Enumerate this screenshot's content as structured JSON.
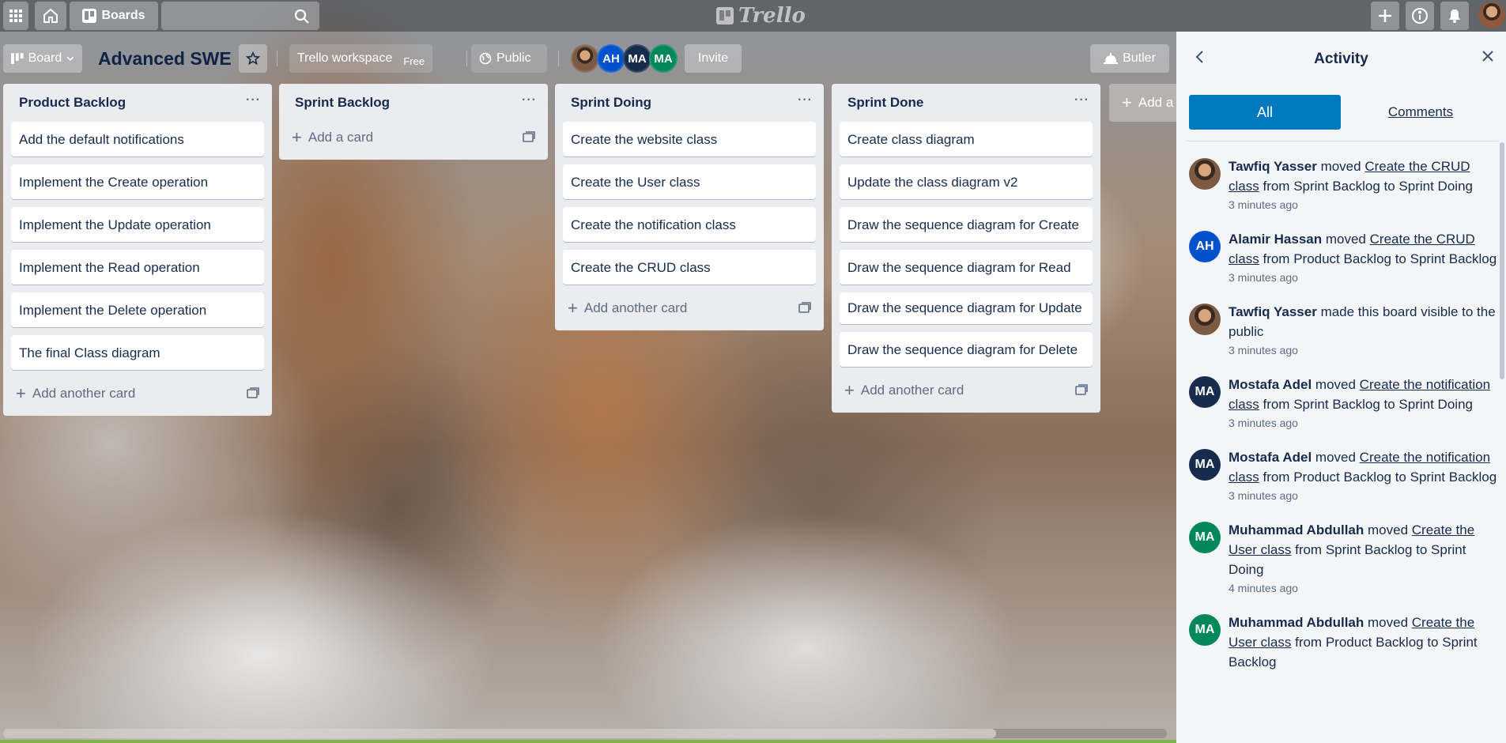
{
  "header": {
    "boards_label": "Boards",
    "logo_text": "Trello"
  },
  "board": {
    "view_label": "Board",
    "title": "Advanced SWE",
    "workspace": "Trello workspace",
    "workspace_badge": "Free",
    "visibility": "Public",
    "members": [
      "",
      "AH",
      "MA",
      "MA"
    ],
    "invite_label": "Invite",
    "butler_label": "Butler",
    "add_list_label": "Add a"
  },
  "lists": [
    {
      "title": "Product Backlog",
      "cards": [
        "Add the default notifications",
        "Implement the Create operation",
        "Implement the Update operation",
        "Implement the Read operation",
        "Implement the Delete operation",
        "The final Class diagram"
      ],
      "add_label": "Add another card"
    },
    {
      "title": "Sprint Backlog",
      "cards": [],
      "add_label": "Add a card"
    },
    {
      "title": "Sprint Doing",
      "cards": [
        "Create the website class",
        "Create the User class",
        "Create the notification class",
        "Create the CRUD class"
      ],
      "add_label": "Add another card"
    },
    {
      "title": "Sprint Done",
      "cards": [
        "Create class diagram",
        "Update the class diagram v2",
        "Draw the sequence diagram for Create",
        "Draw the sequence diagram for Read",
        "Draw the sequence diagram for Update",
        "Draw the sequence diagram for Delete"
      ],
      "add_label": "Add another card"
    }
  ],
  "activity": {
    "title": "Activity",
    "tabs": [
      "All",
      "Comments"
    ],
    "items": [
      {
        "initials": "",
        "name": "Tawfiq Yasser",
        "verb": "moved",
        "link": "Create the CRUD class",
        "rest": "from Sprint Backlog to Sprint Doing",
        "time": "3 minutes ago"
      },
      {
        "initials": "AH",
        "name": "Alamir Hassan",
        "verb": "moved",
        "link": "Create the CRUD class",
        "rest": "from Product Backlog to Sprint Backlog",
        "time": "3 minutes ago"
      },
      {
        "initials": "",
        "name": "Tawfiq Yasser",
        "verb": "made this board visible to the public",
        "link": "",
        "rest": "",
        "time": "3 minutes ago"
      },
      {
        "initials": "MA",
        "name": "Mostafa Adel",
        "verb": "moved",
        "link": "Create the notification class",
        "rest": "from Sprint Backlog to Sprint Doing",
        "time": "3 minutes ago"
      },
      {
        "initials": "MA",
        "name": "Mostafa Adel",
        "verb": "moved",
        "link": "Create the notification class",
        "rest": "from Product Backlog to Sprint Backlog",
        "time": "3 minutes ago"
      },
      {
        "initials": "MA",
        "name": "Muhammad Abdullah",
        "verb": "moved",
        "link": "Create the User class",
        "rest": "from Sprint Backlog to Sprint Doing",
        "time": "4 minutes ago"
      },
      {
        "initials": "MA",
        "name": "Muhammad Abdullah",
        "verb": "moved",
        "link": "Create the User class",
        "rest": "from Product Backlog to Sprint Backlog",
        "time": ""
      }
    ]
  },
  "colors": {
    "accent": "#0079bf",
    "avatar_ah": "#0052cc",
    "avatar_ma_dark": "#172b4d",
    "avatar_ma_green": "#00875a"
  }
}
